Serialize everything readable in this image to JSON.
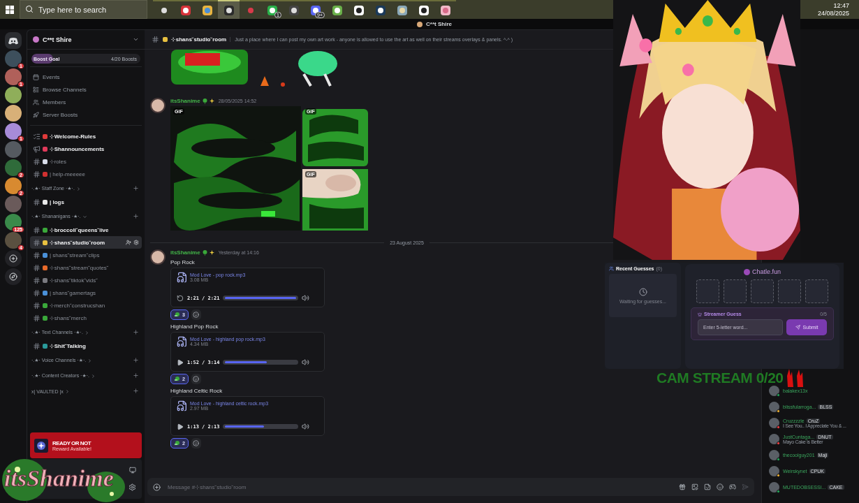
{
  "taskbar": {
    "search": {
      "placeholder": "Type here to search"
    },
    "apps": [
      {
        "kind": "task-view",
        "selected": false
      },
      {
        "kind": "browser",
        "selected": false
      },
      {
        "kind": "folder",
        "selected": false
      },
      {
        "kind": "recorder",
        "selected": true
      },
      {
        "kind": "pin",
        "selected": false
      },
      {
        "kind": "chat",
        "badge": "1",
        "selected": false
      },
      {
        "kind": "wallet",
        "selected": false
      },
      {
        "kind": "voice",
        "badge": "9+",
        "selected": false
      },
      {
        "kind": "sheet",
        "selected": false
      },
      {
        "kind": "editor",
        "selected": false
      },
      {
        "kind": "steam",
        "selected": false
      },
      {
        "kind": "palette",
        "selected": false
      },
      {
        "kind": "editor",
        "selected": false
      },
      {
        "kind": "gallery",
        "selected": false
      }
    ],
    "clock": {
      "time": "12:47",
      "date": "24/08/2025"
    }
  },
  "title_bar": {
    "title": "C**t Shire"
  },
  "servers": [
    {
      "color": "#3d4f5c",
      "badge": "1"
    },
    {
      "color": "#b0605a",
      "badge": "1"
    },
    {
      "color": "#8fae5a"
    },
    {
      "color": "#d8b078"
    },
    {
      "color": "#a78bd8",
      "badge": "1"
    },
    {
      "color": "#555a60"
    },
    {
      "color": "#2f6b3a",
      "badge": "2"
    },
    {
      "color": "#d88a30",
      "badge": "2"
    },
    {
      "color": "#6a5a5a"
    },
    {
      "color": "#3a8a4a",
      "badge": "125"
    },
    {
      "color": "#5a5040",
      "badge": "4"
    }
  ],
  "server_actions": [
    {
      "kind": "add"
    },
    {
      "kind": "discover"
    }
  ],
  "sidebar": {
    "server_name": "C**t Shire",
    "boost": {
      "label": "Boost Goal",
      "count": "4/20 Boosts",
      "level": 0.2
    },
    "nav": [
      {
        "kind": "events",
        "label": "Events"
      },
      {
        "kind": "browse",
        "label": "Browse Channels"
      },
      {
        "kind": "members",
        "label": "Members"
      },
      {
        "kind": "boosts",
        "label": "Server Boosts"
      }
    ],
    "sections": [
      {
        "channels": [
          {
            "kind": "rules",
            "color": "#e03a3a",
            "name": "⊹Welcome-Rules",
            "unread": true,
            "selected": false
          },
          {
            "kind": "announce",
            "color": "#e03a5a",
            "name": "⊹Shannouncements",
            "unread": true,
            "selected": false
          },
          {
            "kind": "text",
            "color": "#d8dce8",
            "name": "⊹roles",
            "unread": false,
            "selected": false
          },
          {
            "kind": "text",
            "color": "#d03030",
            "name": "| help-meeeee",
            "unread": false,
            "selected": false
          }
        ]
      },
      {
        "name": "·.★· Staff Zone ·★·.",
        "expanded": false,
        "channels": [
          {
            "kind": "text",
            "color": "#e8e8e8",
            "name": "| logs",
            "unread": true,
            "selected": false
          }
        ]
      },
      {
        "name": "·.★· Shananigans ·★·.",
        "expanded": true,
        "channels": [
          {
            "kind": "text",
            "color": "#3aa83a",
            "name": "⊹broccoli˘queens˘live",
            "unread": true,
            "selected": false
          },
          {
            "kind": "text",
            "color": "#e8c040",
            "name": "⊹shans˘studio˘room",
            "unread": true,
            "selected": true
          },
          {
            "kind": "text",
            "color": "#4a90d8",
            "name": "| shans˘stream˘clips",
            "unread": false,
            "selected": false
          },
          {
            "kind": "text",
            "color": "#e86a2a",
            "name": "⊹shans˘stream˘quotes˘",
            "unread": false,
            "selected": false
          },
          {
            "kind": "text",
            "color": "#7a7a80",
            "name": "⊹shans˘tiktok˘vids˘",
            "unread": false,
            "selected": false
          },
          {
            "kind": "text",
            "color": "#4a90d8",
            "name": "| shans˘gamertags",
            "unread": false,
            "selected": false
          },
          {
            "kind": "text",
            "color": "#3aa83a",
            "name": "⊹merch˘construcshan",
            "unread": false,
            "selected": false
          },
          {
            "kind": "text",
            "color": "#3aa83a",
            "name": "⊹shans˘merch",
            "unread": false,
            "selected": false
          }
        ]
      },
      {
        "name": "·.★· Text Channels ·★·.",
        "expanded": false,
        "channels": [
          {
            "kind": "text",
            "color": "#2a9a9a",
            "name": "⊹Shit˘Talking",
            "unread": true,
            "selected": false
          }
        ]
      },
      {
        "name": "·.★· Voice Channels ·★·.",
        "expanded": false
      },
      {
        "name": "·.★· Content Creators ·★·.",
        "expanded": false
      },
      {
        "name": "x| VAULTED |x",
        "expanded": false
      }
    ]
  },
  "notice": {
    "title": "READY OR NOT",
    "subtitle": "Reward Available!"
  },
  "overlay_logo": {
    "text": "itsShanime"
  },
  "chat": {
    "header": {
      "channel": "⊹shans˘studio˘room",
      "color": "#e8c040",
      "topic": "Just a place where I can post my own art work - anyone is allowed to use the art as well on their streams overlays & panels. ^-^ )"
    },
    "feed": [
      {
        "kind": "art"
      },
      {
        "kind": "gifs",
        "author": "itsShanime",
        "time": "28/05/2025 14:52",
        "gifs": [
          "GIF",
          "GIF",
          "GIF"
        ]
      },
      {
        "kind": "divider",
        "label": "23 August 2025"
      },
      {
        "kind": "tracks",
        "author": "itsShanime",
        "time": "Yesterday at 14:16",
        "tracks": [
          {
            "title": "Pop Rock",
            "file": "Mod Love - pop rock.mp3",
            "size": "3.08 MB",
            "time": "2:21 / 2:21",
            "ended": true,
            "level": 1,
            "reaction": "3"
          },
          {
            "title": "Highland Pop Rock",
            "file": "Mod Love - highland pop rock.mp3",
            "size": "4.34 MB",
            "time": "1:52 / 3:14",
            "ended": false,
            "level": 0.58,
            "reaction": "2"
          },
          {
            "title": "Highland Celtic Rock",
            "file": "Mod Love - highland celtic rock.mp3",
            "size": "2.97 MB",
            "time": "1:13 / 2:13",
            "ended": false,
            "level": 0.55,
            "reaction": "2"
          }
        ]
      }
    ],
    "composer": {
      "placeholder": "Message #⊹shans˘studio˘room"
    }
  },
  "members": [
    {
      "name": "balakex13x",
      "color": "#23a55a"
    },
    {
      "name": "blissfularroga...",
      "tag": "BLSS",
      "color": "#f0b232"
    },
    {
      "name": "Cruzzzzle",
      "tag": "CruZ",
      "status": "I See You.. I Appreciate You & ...",
      "color": "#f23f43"
    },
    {
      "name": "JustCuntaga...",
      "tag": "DNUT",
      "status": "Mayo Cake is Better",
      "color": "#f23f43"
    },
    {
      "name": "thecoolguy201",
      "tag": "Maji",
      "color": "#23a55a"
    },
    {
      "name": "Weirskynet",
      "tag": "CPUK",
      "color": "#f0b232"
    },
    {
      "name": "MUTEDOBSESSI...",
      "tag": "CAKE",
      "color": "#23a55a"
    }
  ],
  "game": {
    "recent": {
      "title": "Recent Guesses",
      "count": "(0)",
      "empty": "Waiting for guesses..."
    },
    "title": "Chatle.fun",
    "tiles": [
      {
        "filled": false
      },
      {
        "filled": false
      },
      {
        "filled": false
      },
      {
        "filled": false
      },
      {
        "filled": false
      }
    ],
    "guess": {
      "label": "Streamer Guess",
      "count": "0/5",
      "placeholder": "Enter 5-letter word...",
      "button": "Submit"
    }
  },
  "cam_banner": {
    "text": "CAM STREAM 0/20"
  }
}
